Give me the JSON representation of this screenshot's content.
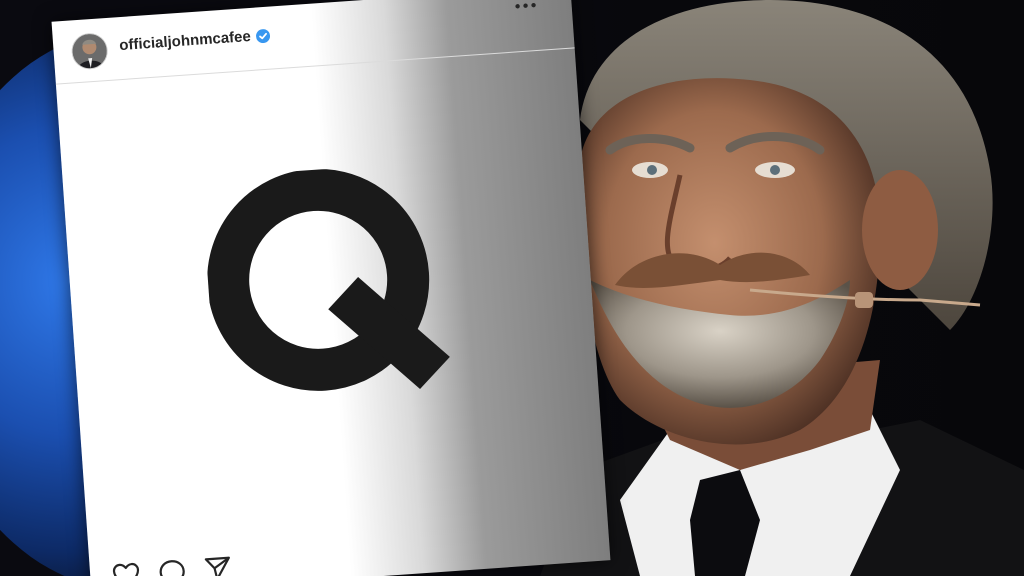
{
  "post": {
    "username": "officialjohnmcafee",
    "verified": true,
    "image_content": "Q",
    "icons": [
      "more-options-icon",
      "verified-badge-icon",
      "heart-icon",
      "comment-icon",
      "share-icon"
    ]
  },
  "colors": {
    "verified_blue": "#3897f0",
    "text_dark": "#262626",
    "q_black": "#1a1a1a",
    "background_blue": "#2f78e8"
  }
}
